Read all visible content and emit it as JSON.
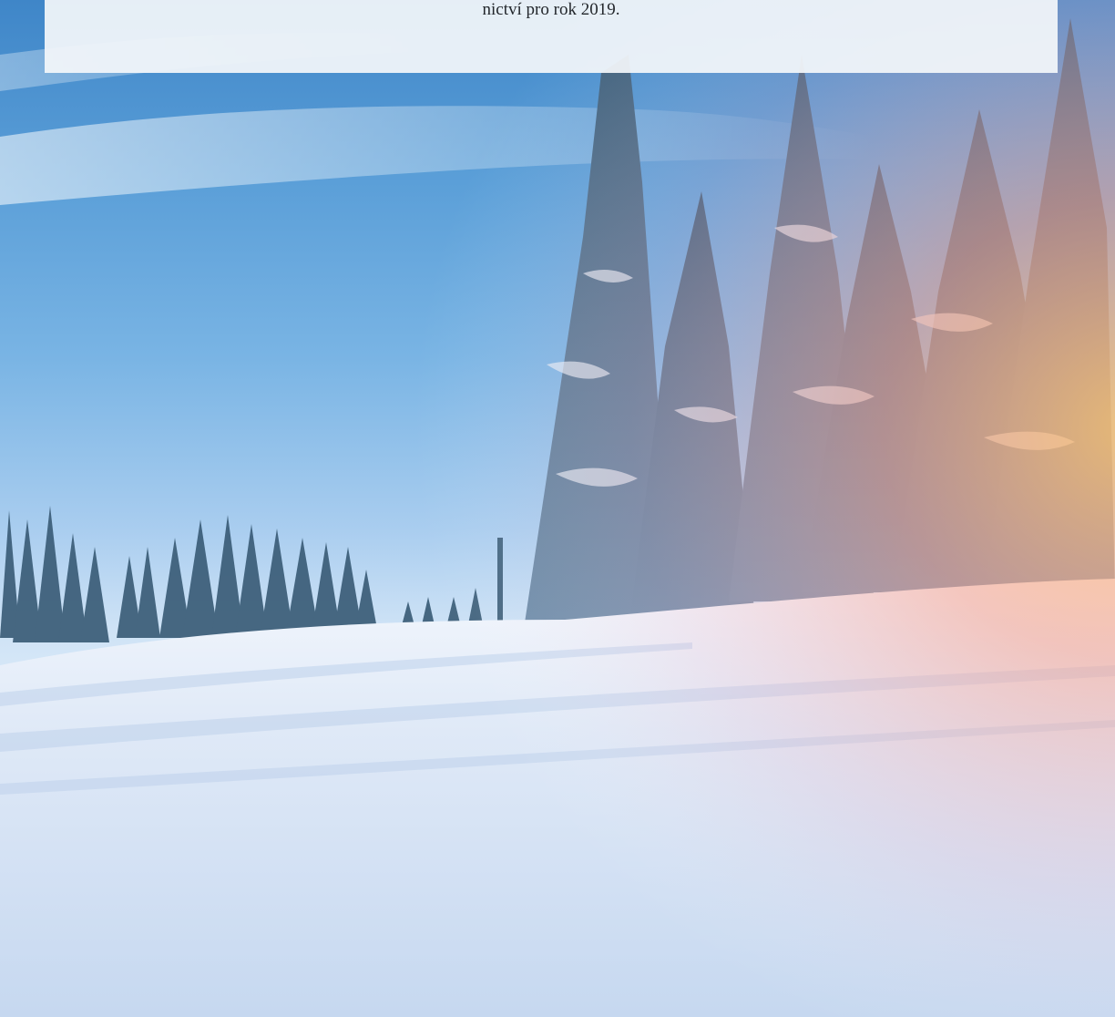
{
  "document": {
    "text_fragment": "nictví pro rok 2019."
  },
  "background": {
    "subject": "snowy winter landscape with snow-covered spruce trees under a blue sky with warm sunlight flare on the right",
    "colors": {
      "sky_top": "#3f86c8",
      "sky_mid": "#a9cdef",
      "snow": "#e6eef9",
      "tree_dark": "#2c4a63",
      "sun_flare": "#f7b27a"
    }
  }
}
